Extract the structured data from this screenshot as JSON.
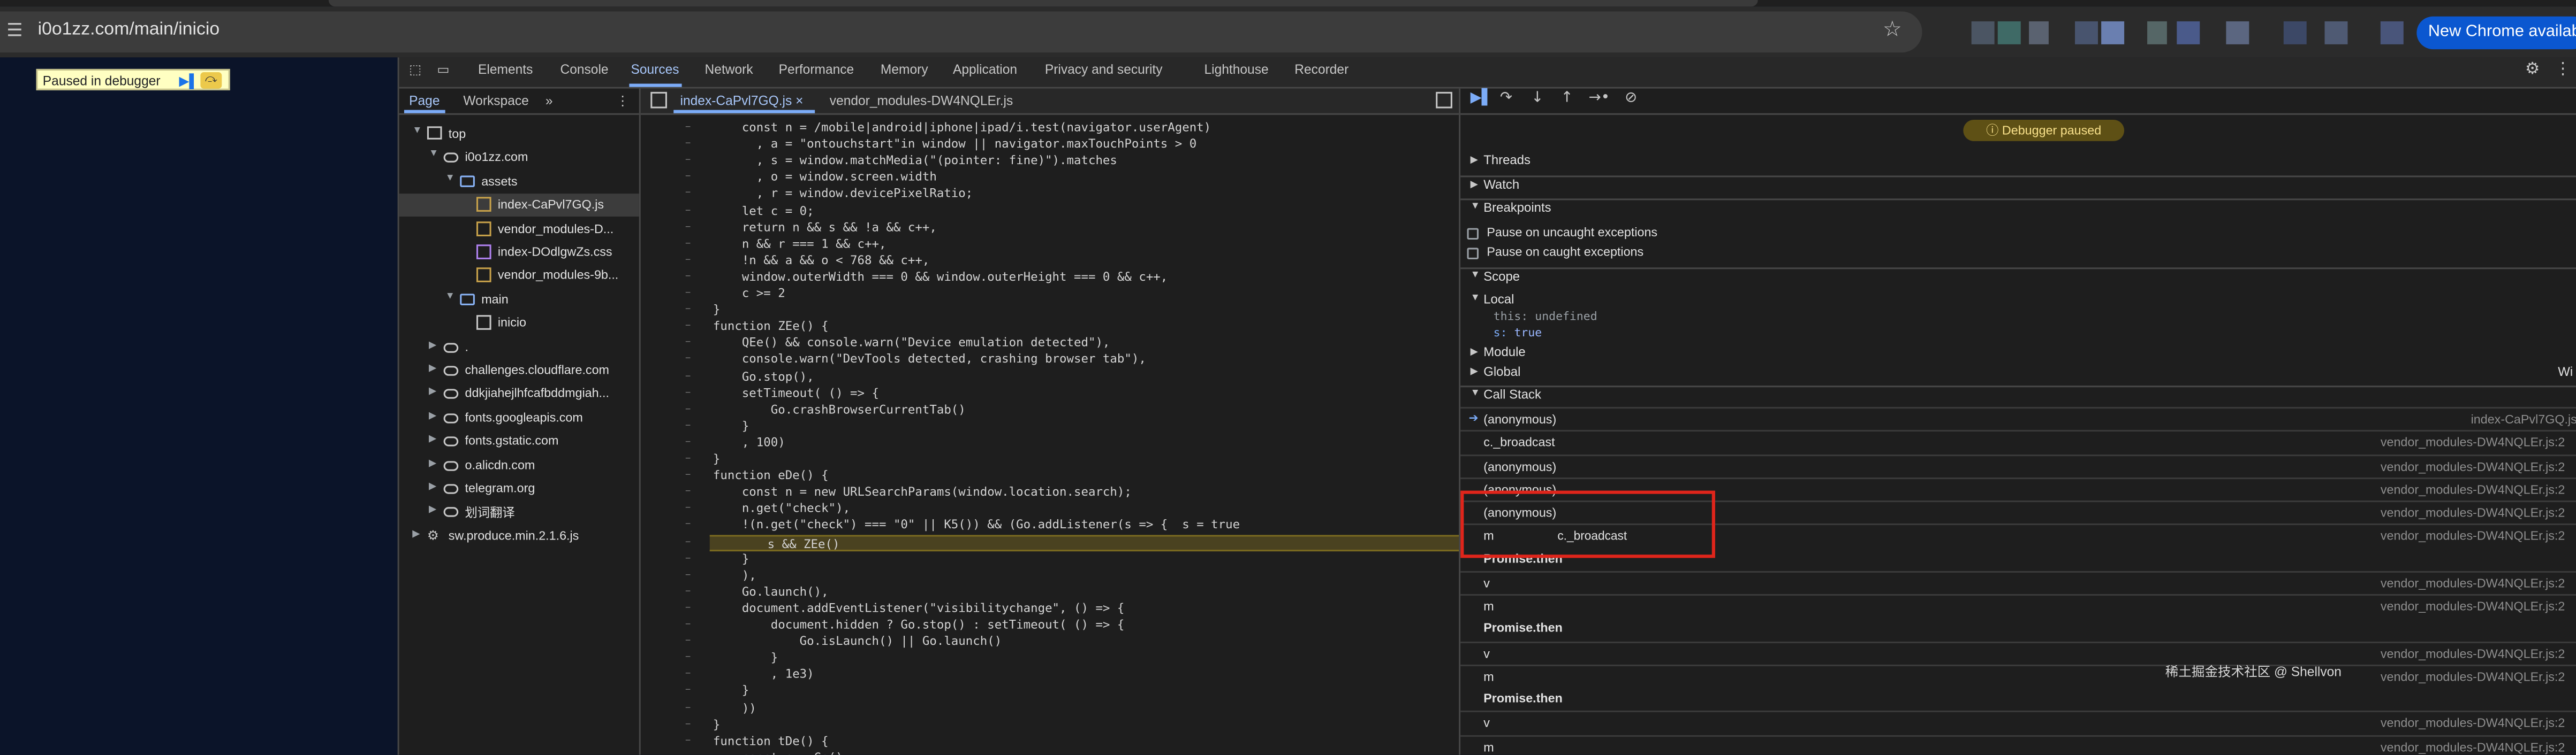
{
  "browser": {
    "url": "i0o1zz.com/main/inicio",
    "new_chrome_label": "New Chrome available",
    "star_icon": "star-icon",
    "site_icon": "tune-icon"
  },
  "page": {
    "paused_text": "Paused in debugger"
  },
  "devtools": {
    "tabs": [
      "Elements",
      "Console",
      "Sources",
      "Network",
      "Performance",
      "Memory",
      "Application",
      "Privacy and security",
      "Lighthouse",
      "Recorder"
    ],
    "active_tab": "Sources",
    "accent": "#a8c7fa"
  },
  "navigator": {
    "tabs": [
      "Page",
      "Workspace"
    ],
    "tree": [
      {
        "label": "top",
        "kind": "frame",
        "depth": 0,
        "expanded": true
      },
      {
        "label": "i0o1zz.com",
        "kind": "cloud",
        "depth": 1,
        "expanded": true
      },
      {
        "label": "assets",
        "kind": "folder",
        "depth": 2,
        "expanded": true
      },
      {
        "label": "index-CaPvl7GQ.js",
        "kind": "file-js",
        "depth": 3,
        "selected": true
      },
      {
        "label": "vendor_modules-D...",
        "kind": "file-js",
        "depth": 3
      },
      {
        "label": "index-DOdlgwZs.css",
        "kind": "file-css",
        "depth": 3
      },
      {
        "label": "vendor_modules-9b...",
        "kind": "file-js",
        "depth": 3
      },
      {
        "label": "main",
        "kind": "folder",
        "depth": 2,
        "expanded": true
      },
      {
        "label": "inicio",
        "kind": "file-doc",
        "depth": 3
      },
      {
        "label": ".",
        "kind": "cloud",
        "depth": 1,
        "expanded": false
      },
      {
        "label": "challenges.cloudflare.com",
        "kind": "cloud",
        "depth": 1,
        "expanded": false
      },
      {
        "label": "ddkjiahejlhfcafbddmgiah...",
        "kind": "cloud",
        "depth": 1,
        "expanded": false
      },
      {
        "label": "fonts.googleapis.com",
        "kind": "cloud",
        "depth": 1,
        "expanded": false
      },
      {
        "label": "fonts.gstatic.com",
        "kind": "cloud",
        "depth": 1,
        "expanded": false
      },
      {
        "label": "o.alicdn.com",
        "kind": "cloud",
        "depth": 1,
        "expanded": false
      },
      {
        "label": "telegram.org",
        "kind": "cloud",
        "depth": 1,
        "expanded": false
      },
      {
        "label": "划词翻译",
        "kind": "cloud",
        "depth": 1,
        "expanded": false
      },
      {
        "label": "sw.produce.min.2.1.6.js",
        "kind": "gear",
        "depth": 0,
        "expanded": false
      }
    ]
  },
  "editor": {
    "tabs": [
      "index-CaPvl7GQ.js",
      "vendor_modules-DW4NQLEr.js"
    ],
    "active_tab": "index-CaPvl7GQ.js",
    "highlight_line_index": 25,
    "lines": [
      "    const n = /mobile|android|iphone|ipad/i.test(navigator.userAgent)",
      "      , a = \"ontouchstart\"in window || navigator.maxTouchPoints > 0",
      "      , s = window.matchMedia(\"(pointer: fine)\").matches",
      "      , o = window.screen.width",
      "      , r = window.devicePixelRatio;",
      "    let c = 0;",
      "    return n && s && !a && c++,",
      "    n && r === 1 && c++,",
      "    !n && a && o < 768 && c++,",
      "    window.outerWidth === 0 && window.outerHeight === 0 && c++,",
      "    c >= 2",
      "}",
      "function ZEe() {",
      "    QEe() && console.warn(\"Device emulation detected\"),",
      "    console.warn(\"DevTools detected, crashing browser tab\"),",
      "    Go.stop(),",
      "    setTimeout( () => {",
      "        Go.crashBrowserCurrentTab()",
      "    }",
      "    , 100)",
      "}",
      "function eDe() {",
      "    const n = new URLSearchParams(window.location.search);",
      "    n.get(\"check\"),",
      "    !(n.get(\"check\") === \"0\" || K5()) && (Go.addListener(s => {  s = true",
      "        s && ZEe()",
      "    }",
      "    ),",
      "    Go.launch(),",
      "    document.addEventListener(\"visibilitychange\", () => {",
      "        document.hidden ? Go.stop() : setTimeout( () => {",
      "            Go.isLaunch() || Go.launch()",
      "        }",
      "        , 1e3)",
      "    }",
      "    ))",
      "}",
      "function tDe() {",
      "    const n = Ge()"
    ]
  },
  "debugger": {
    "status": "Debugger paused",
    "sections": {
      "threads": "Threads",
      "watch": "Watch",
      "breakpoints": "Breakpoints",
      "scope": "Scope",
      "call_stack": "Call Stack"
    },
    "checkboxes": [
      "Pause on uncaught exceptions",
      "Pause on caught exceptions"
    ],
    "scope": {
      "local_label": "Local",
      "this_key": "this:",
      "this_val": "undefined",
      "s_key": "s:",
      "s_val": "true",
      "module_label": "Module",
      "global_label": "Global",
      "global_val": "Wi"
    },
    "call_stack": [
      {
        "fn": "(anonymous)",
        "loc": "index-CaPvl7GQ.js",
        "current": true
      },
      {
        "fn": "c._broadcast",
        "loc": "vendor_modules-DW4NQLEr.js:2"
      },
      {
        "fn": "(anonymous)",
        "loc": "vendor_modules-DW4NQLEr.js:2"
      },
      {
        "fn": "(anonymous)",
        "loc": "vendor_modules-DW4NQLEr.js:2"
      },
      {
        "fn": "(anonymous)",
        "loc": "vendor_modules-DW4NQLEr.js:2"
      },
      {
        "fn": "m",
        "loc": "vendor_modules-DW4NQLEr.js:2"
      },
      {
        "fn": "Promise.then",
        "async": true
      },
      {
        "fn": "v",
        "loc": "vendor_modules-DW4NQLEr.js:2"
      },
      {
        "fn": "m",
        "loc": "vendor_modules-DW4NQLEr.js:2"
      },
      {
        "fn": "Promise.then",
        "async": true
      },
      {
        "fn": "v",
        "loc": "vendor_modules-DW4NQLEr.js:2"
      },
      {
        "fn": "m",
        "loc": "vendor_modules-DW4NQLEr.js:2"
      },
      {
        "fn": "Promise.then",
        "async": true
      },
      {
        "fn": "v",
        "loc": "vendor_modules-DW4NQLEr.js:2"
      },
      {
        "fn": "m",
        "loc": "vendor_modules-DW4NQLEr.js:2"
      }
    ],
    "hover_tooltip": "c._broadcast"
  },
  "watermark": "稀土掘金技术社区 @ Shellvon"
}
